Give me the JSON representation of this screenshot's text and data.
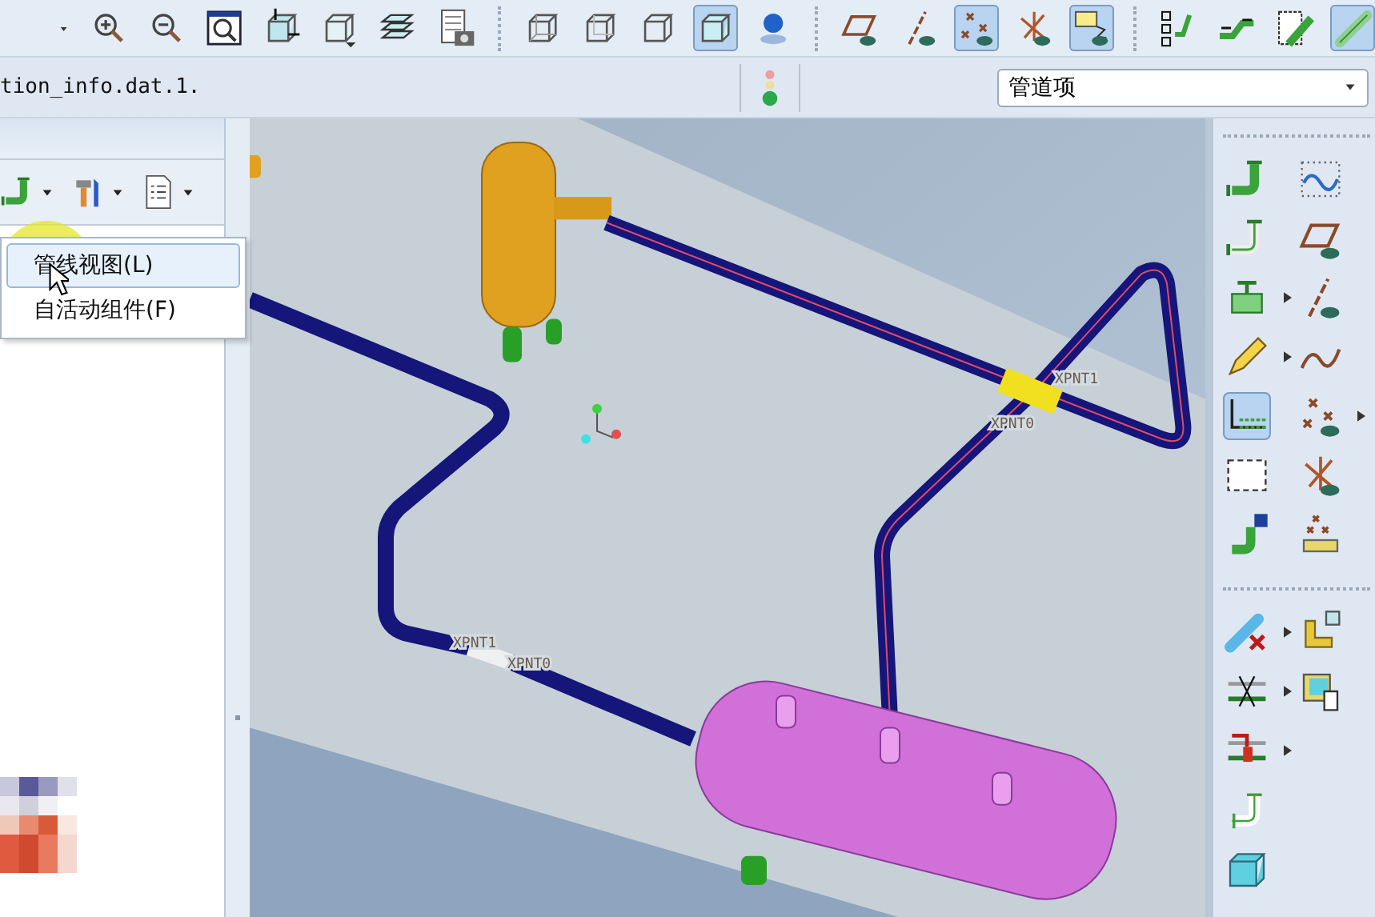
{
  "toolbar": [
    [
      {
        "kind": "caret",
        "pressed": false
      },
      {
        "kind": "zoom-in",
        "pressed": false
      },
      {
        "kind": "zoom-out",
        "pressed": false
      },
      {
        "kind": "zoom-box",
        "pressed": false
      },
      {
        "kind": "reorient",
        "pressed": false
      },
      {
        "kind": "saved-views",
        "pressed": false
      },
      {
        "kind": "layers",
        "pressed": false
      },
      {
        "kind": "view-manager",
        "pressed": false
      }
    ],
    [
      {
        "kind": "wireframe",
        "pressed": false
      },
      {
        "kind": "hidden-line",
        "pressed": false
      },
      {
        "kind": "no-hidden",
        "pressed": false
      },
      {
        "kind": "shaded",
        "pressed": true
      },
      {
        "kind": "sphere",
        "pressed": false
      }
    ],
    [
      {
        "kind": "plane",
        "pressed": false
      },
      {
        "kind": "axis",
        "pressed": false
      },
      {
        "kind": "points",
        "pressed": true
      },
      {
        "kind": "csys",
        "pressed": false
      },
      {
        "kind": "note",
        "pressed": true
      }
    ],
    [
      {
        "kind": "pipe-tree",
        "pressed": false
      },
      {
        "kind": "pipe-flow",
        "pressed": false
      },
      {
        "kind": "pipe-list",
        "pressed": false
      },
      {
        "kind": "pipe-solid",
        "pressed": true
      }
    ]
  ],
  "message": "tion_info.dat.1.",
  "filter": {
    "value": "管道项"
  },
  "left_toolbar": [
    {
      "kind": "pipe-route"
    },
    {
      "kind": "tools"
    },
    {
      "kind": "list"
    }
  ],
  "menu": {
    "items": [
      {
        "label": "管线视图(L)",
        "selected": true
      },
      {
        "label": "自活动组件(F)",
        "selected": false
      }
    ]
  },
  "point_labels": [
    "XPNT1",
    "XPNT0",
    "XPNT1",
    "XPNT0"
  ],
  "right_toolbar": {
    "upper": {
      "left": [
        {
          "kind": "pipe-route",
          "pressed": false,
          "has_menu": false
        },
        {
          "kind": "pipe-route2",
          "pressed": false,
          "has_menu": false
        },
        {
          "kind": "valve",
          "pressed": false,
          "has_menu": true
        },
        {
          "kind": "pencil",
          "pressed": false,
          "has_menu": true
        },
        {
          "kind": "sketch",
          "pressed": true,
          "has_menu": false
        },
        {
          "kind": "dashed-box",
          "pressed": false,
          "has_menu": false
        },
        {
          "kind": "pipe-info",
          "pressed": false,
          "has_menu": false
        }
      ],
      "right": [
        {
          "kind": "curve",
          "pressed": false,
          "has_menu": false
        },
        {
          "kind": "plane",
          "pressed": false,
          "has_menu": false
        },
        {
          "kind": "axis",
          "pressed": false,
          "has_menu": false
        },
        {
          "kind": "spline",
          "pressed": false,
          "has_menu": false
        },
        {
          "kind": "points",
          "pressed": false,
          "has_menu": true
        },
        {
          "kind": "csys",
          "pressed": false,
          "has_menu": false
        },
        {
          "kind": "point-array",
          "pressed": false,
          "has_menu": false
        }
      ]
    },
    "lower": {
      "left": [
        {
          "kind": "pipe-delete",
          "pressed": false,
          "has_menu": true
        },
        {
          "kind": "split",
          "pressed": false,
          "has_menu": true
        },
        {
          "kind": "insert",
          "pressed": false,
          "has_menu": true
        },
        {
          "kind": "pipe-segment",
          "pressed": false,
          "has_menu": false
        },
        {
          "kind": "solid",
          "pressed": false,
          "has_menu": false
        }
      ],
      "right": [
        {
          "kind": "corner",
          "pressed": false,
          "has_menu": false
        },
        {
          "kind": "copy",
          "pressed": false,
          "has_menu": false
        }
      ]
    }
  }
}
